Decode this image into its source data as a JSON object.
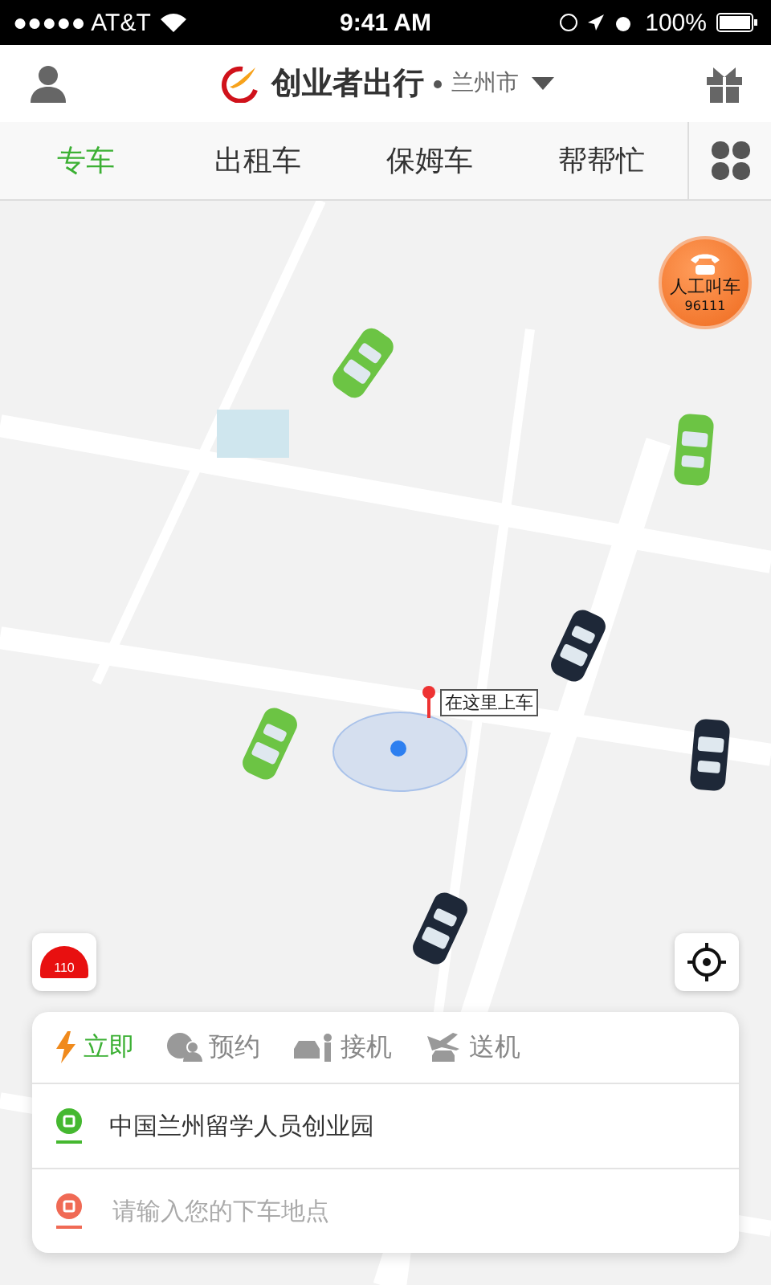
{
  "status_bar": {
    "carrier": "●●●●● AT&T",
    "time": "9:41 AM",
    "battery": "100%"
  },
  "header": {
    "brand": "创业者出行",
    "city": "兰州市"
  },
  "tabs": [
    {
      "label": "专车",
      "selected": true
    },
    {
      "label": "出租车",
      "selected": false
    },
    {
      "label": "保姆车",
      "selected": false
    },
    {
      "label": "帮帮忙",
      "selected": false
    }
  ],
  "map": {
    "call_button": {
      "title": "人工叫车",
      "number": "96111"
    },
    "pickup_label": "在这里上车",
    "alarm_label": "110",
    "cars": [
      {
        "kind": "taxi"
      },
      {
        "kind": "taxi"
      },
      {
        "kind": "private"
      },
      {
        "kind": "taxi"
      },
      {
        "kind": "private"
      },
      {
        "kind": "private"
      }
    ]
  },
  "booking": {
    "modes": [
      {
        "kind": "now",
        "label": "立即",
        "selected": true
      },
      {
        "kind": "reserve",
        "label": "预约",
        "selected": false
      },
      {
        "kind": "pickup",
        "label": "接机",
        "selected": false
      },
      {
        "kind": "dropoff",
        "label": "送机",
        "selected": false
      }
    ],
    "origin": "中国兰州留学人员创业园",
    "destination_placeholder": "请输入您的下车地点"
  }
}
